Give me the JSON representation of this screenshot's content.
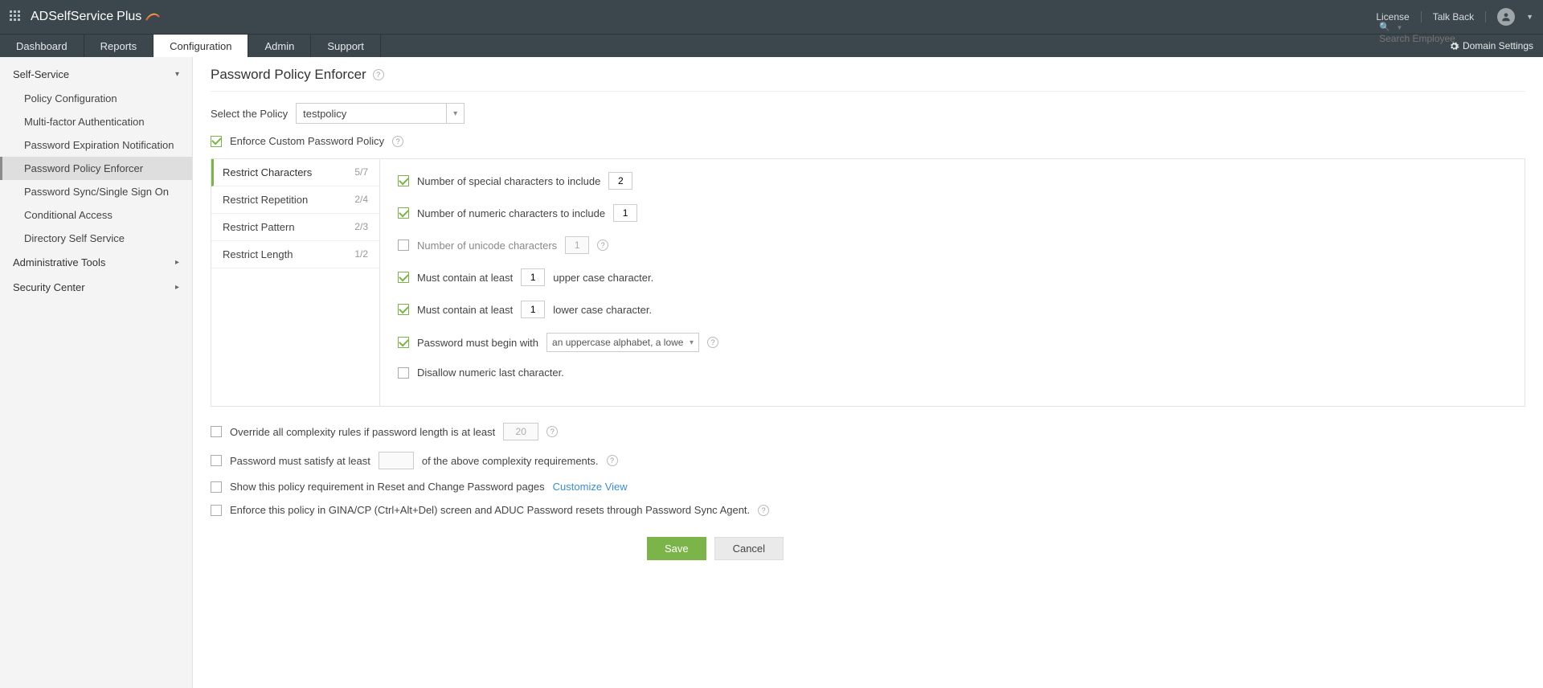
{
  "topbar": {
    "brand_main": "ADSelfService",
    "brand_suffix": "Plus",
    "license": "License",
    "talkback": "Talk Back",
    "search_placeholder": "Search Employee"
  },
  "nav": {
    "tabs": [
      "Dashboard",
      "Reports",
      "Configuration",
      "Admin",
      "Support"
    ],
    "domain_settings": "Domain Settings"
  },
  "sidebar": {
    "sections": {
      "self_service": "Self-Service",
      "admin_tools": "Administrative Tools",
      "security_center": "Security Center"
    },
    "items": [
      "Policy Configuration",
      "Multi-factor Authentication",
      "Password Expiration Notification",
      "Password Policy Enforcer",
      "Password Sync/Single Sign On",
      "Conditional Access",
      "Directory Self Service"
    ]
  },
  "page": {
    "title": "Password Policy Enforcer",
    "select_policy_label": "Select the Policy",
    "selected_policy": "testpolicy",
    "enforce_label": "Enforce Custom Password Policy"
  },
  "rule_tabs": [
    {
      "label": "Restrict Characters",
      "count": "5/7"
    },
    {
      "label": "Restrict Repetition",
      "count": "2/4"
    },
    {
      "label": "Restrict Pattern",
      "count": "2/3"
    },
    {
      "label": "Restrict Length",
      "count": "1/2"
    }
  ],
  "rules": {
    "special_label": "Number of special characters to include",
    "special_val": "2",
    "numeric_label": "Number of numeric characters to include",
    "numeric_val": "1",
    "unicode_label": "Number of unicode characters",
    "unicode_val": "1",
    "upper_pre": "Must contain at least",
    "upper_val": "1",
    "upper_post": "upper case character.",
    "lower_pre": "Must contain at least",
    "lower_val": "1",
    "lower_post": "lower case character.",
    "begin_label": "Password must begin with",
    "begin_val": "an uppercase alphabet, a lowe",
    "disallow_numeric_last": "Disallow numeric last character."
  },
  "bottom": {
    "override_pre": "Override all complexity rules if password length is at least",
    "override_val": "20",
    "satisfy_pre": "Password must satisfy at least",
    "satisfy_post": "of the above complexity requirements.",
    "show_policy": "Show this policy requirement in Reset and Change Password pages",
    "customize_view": "Customize View",
    "enforce_gina": "Enforce this policy in GINA/CP (Ctrl+Alt+Del) screen and ADUC Password resets through Password Sync Agent."
  },
  "buttons": {
    "save": "Save",
    "cancel": "Cancel"
  }
}
